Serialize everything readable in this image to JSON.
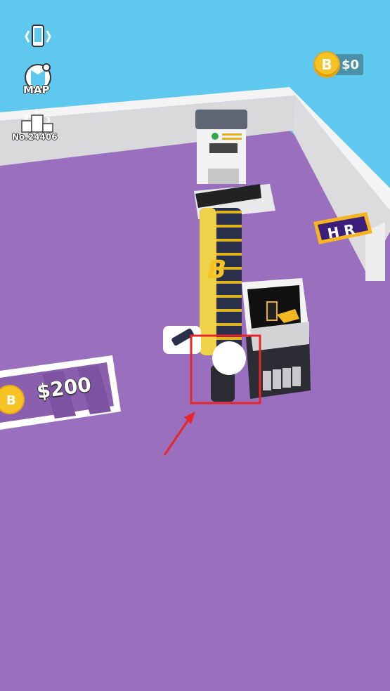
{
  "hud": {
    "balance": "$0",
    "coin_symbol": "B",
    "map_label": "MAP",
    "rank_label": "No.24406",
    "podium": [
      "1",
      "2",
      "3"
    ]
  },
  "world": {
    "unlock_price": "$200",
    "hr_sign": "H R",
    "machine_symbol": "B"
  },
  "colors": {
    "floor": "#9a6fbd",
    "sky": "#5ec8ef",
    "coin": "#f6c325",
    "highlight": "#e8262a"
  }
}
